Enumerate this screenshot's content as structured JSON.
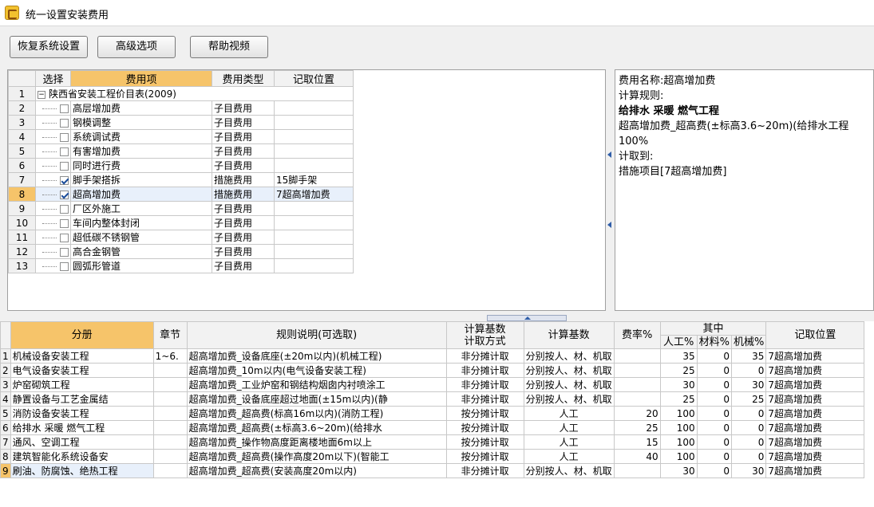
{
  "window": {
    "title": "统一设置安装费用"
  },
  "toolbar": {
    "restore": "恢复系统设置",
    "advanced": "高级选项",
    "help_video": "帮助视频"
  },
  "upper": {
    "headers": {
      "select": "选择",
      "fee_item": "费用项",
      "fee_type": "费用类型",
      "location": "记取位置"
    },
    "group": {
      "no": "1",
      "label": "陕西省安装工程价目表(2009)",
      "expand": "−"
    },
    "rows": [
      {
        "no": "2",
        "name": "高层增加费",
        "checked": false,
        "type": "子目费用",
        "loc": ""
      },
      {
        "no": "3",
        "name": "钢模调整",
        "checked": false,
        "type": "子目费用",
        "loc": ""
      },
      {
        "no": "4",
        "name": "系统调试费",
        "checked": false,
        "type": "子目费用",
        "loc": ""
      },
      {
        "no": "5",
        "name": "有害增加费",
        "checked": false,
        "type": "子目费用",
        "loc": ""
      },
      {
        "no": "6",
        "name": "同时进行费",
        "checked": false,
        "type": "子目费用",
        "loc": ""
      },
      {
        "no": "7",
        "name": "脚手架搭拆",
        "checked": true,
        "type": "措施费用",
        "loc": "15脚手架"
      },
      {
        "no": "8",
        "name": "超高增加费",
        "checked": true,
        "type": "措施费用",
        "loc": "7超高增加费"
      },
      {
        "no": "9",
        "name": "厂区外施工",
        "checked": false,
        "type": "子目费用",
        "loc": ""
      },
      {
        "no": "10",
        "name": "车间内整体封闭",
        "checked": false,
        "type": "子目费用",
        "loc": ""
      },
      {
        "no": "11",
        "name": "超低碳不锈钢管",
        "checked": false,
        "type": "子目费用",
        "loc": ""
      },
      {
        "no": "12",
        "name": "高合金钢管",
        "checked": false,
        "type": "子目费用",
        "loc": ""
      },
      {
        "no": "13",
        "name": "圆弧形管道",
        "checked": false,
        "type": "子目费用",
        "loc": ""
      }
    ]
  },
  "info": {
    "line1": "费用名称:超高增加费",
    "line2": "计算规则:",
    "line3": "给排水 采暖 燃气工程",
    "line4": "超高增加费_超高费(±标高3.6~20m)(给排水工程",
    "line5": "100%",
    "line6": "计取到:",
    "line7": "措施项目[7超高增加费]"
  },
  "lower": {
    "headers": {
      "division": "分册",
      "chapter": "章节",
      "rule": "规则说明(可选取)",
      "method": "计算基数\n计取方式",
      "base": "计算基数",
      "rate": "费率%",
      "of_which": "其中",
      "labor": "人工%",
      "material": "材料%",
      "machine": "机械%",
      "location": "记取位置"
    },
    "rows": [
      {
        "no": "1",
        "division": "机械设备安装工程",
        "chapter": "1~6.",
        "rule": "超高增加费_设备底座(±20m以内)(机械工程)",
        "method": "非分摊计取",
        "base": "分别按人、材、机取",
        "rate": "",
        "labor": "35",
        "material": "0",
        "machine": "35",
        "loc": "7超高增加费"
      },
      {
        "no": "2",
        "division": "电气设备安装工程",
        "chapter": "",
        "rule": "超高增加费_10m以内(电气设备安装工程)",
        "method": "非分摊计取",
        "base": "分别按人、材、机取",
        "rate": "",
        "labor": "25",
        "material": "0",
        "machine": "0",
        "loc": "7超高增加费"
      },
      {
        "no": "3",
        "division": "炉窑砌筑工程",
        "chapter": "",
        "rule": "超高增加费_工业炉窑和钢结构烟囱内衬喷涂工",
        "method": "非分摊计取",
        "base": "分别按人、材、机取",
        "rate": "",
        "labor": "30",
        "material": "0",
        "machine": "30",
        "loc": "7超高增加费"
      },
      {
        "no": "4",
        "division": "静置设备与工艺金属结",
        "chapter": "",
        "rule": "超高增加费_设备底座超过地面(±15m以内)(静",
        "method": "非分摊计取",
        "base": "分别按人、材、机取",
        "rate": "",
        "labor": "25",
        "material": "0",
        "machine": "25",
        "loc": "7超高增加费"
      },
      {
        "no": "5",
        "division": "消防设备安装工程",
        "chapter": "",
        "rule": "超高增加费_超高费(标高16m以内)(消防工程)",
        "method": "按分摊计取",
        "base": "人工",
        "rate": "20",
        "labor": "100",
        "material": "0",
        "machine": "0",
        "loc": "7超高增加费"
      },
      {
        "no": "6",
        "division": "给排水 采暖 燃气工程",
        "chapter": "",
        "rule": "超高增加费_超高费(±标高3.6~20m)(给排水",
        "method": "按分摊计取",
        "base": "人工",
        "rate": "25",
        "labor": "100",
        "material": "0",
        "machine": "0",
        "loc": "7超高增加费"
      },
      {
        "no": "7",
        "division": "通风、空调工程",
        "chapter": "",
        "rule": "超高增加费_操作物高度距离楼地面6m以上",
        "method": "按分摊计取",
        "base": "人工",
        "rate": "15",
        "labor": "100",
        "material": "0",
        "machine": "0",
        "loc": "7超高增加费"
      },
      {
        "no": "8",
        "division": "建筑智能化系统设备安",
        "chapter": "",
        "rule": "超高增加费_超高费(操作高度20m以下)(智能工",
        "method": "按分摊计取",
        "base": "人工",
        "rate": "40",
        "labor": "100",
        "material": "0",
        "machine": "0",
        "loc": "7超高增加费"
      },
      {
        "no": "9",
        "division": "刷油、防腐蚀、绝热工程",
        "chapter": "",
        "rule": "超高增加费_超高费(安装高度20m以内)",
        "method": "非分摊计取",
        "base": "分别按人、材、机取",
        "rate": "",
        "labor": "30",
        "material": "0",
        "machine": "30",
        "loc": "7超高增加费"
      }
    ]
  }
}
